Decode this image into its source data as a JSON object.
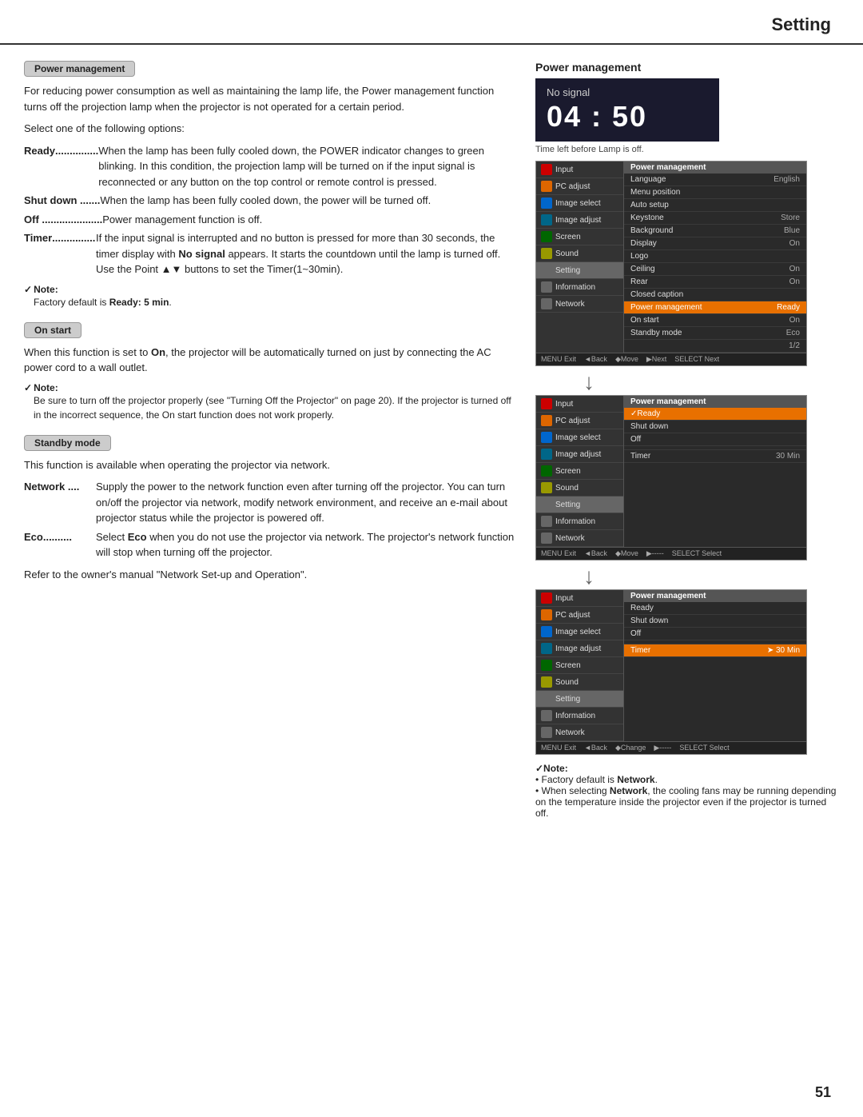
{
  "header": {
    "title": "Setting"
  },
  "left": {
    "power_management_label": "Power management",
    "power_management_intro": "For reducing power consumption as well as maintaining the lamp life, the Power management function turns off the projection lamp when the projector is not operated for a certain period.",
    "select_options": "Select one of the following options:",
    "definitions": [
      {
        "term": "Ready",
        "dots": "...............",
        "desc": "When the lamp has been fully cooled down, the POWER indicator changes to green blinking. In this condition, the projection lamp will be turned on if the input signal is reconnected or any button on the top control or remote control is pressed."
      },
      {
        "term": "Shut down",
        "dots": " .......",
        "desc": "When the lamp has been fully cooled down, the power will be turned off."
      },
      {
        "term": "Off",
        "dots": " ...................",
        "desc": "Power management function is off."
      },
      {
        "term": "Timer",
        "dots": "...............",
        "desc": "If the input signal is interrupted and no button is pressed for more than 30 seconds, the timer display with No signal appears. It starts the countdown until the lamp is turned off. Use the Point ▲▼ buttons to set the Timer(1~30min)."
      }
    ],
    "note1_title": "Note:",
    "note1_text": "Factory default is Ready: 5 min.",
    "on_start_label": "On start",
    "on_start_text": "When this function is set to On, the projector will be automatically turned on just by connecting the AC power cord to a wall outlet.",
    "note2_title": "Note:",
    "note2_text": "Be sure to turn off the projector properly (see \"Turning Off the Projector\" on page 20). If the projector is turned off in the incorrect sequence, the On start function does not work properly.",
    "standby_mode_label": "Standby mode",
    "standby_mode_text": "This function is available when operating the projector via network.",
    "standby_defs": [
      {
        "term": "Network",
        "dots": " ....",
        "desc": "Supply the power to the network function even after turning off the projector. You can turn on/off the projector via network, modify network environment, and receive an e-mail about projector status while the projector is powered off."
      },
      {
        "term": "Eco",
        "dots": "..........",
        "desc": "Select Eco when you do not use the projector via network. The projector's network function will stop when turning off the projector."
      }
    ],
    "refer_text": "Refer to the owner's manual \"Network Set-up and Operation\"."
  },
  "right": {
    "pm_title": "Power management",
    "no_signal": "No signal",
    "timer_display": "04 : 50",
    "time_left_caption": "Time left before Lamp is off.",
    "panels": [
      {
        "id": "panel1",
        "left_items": [
          {
            "label": "Input",
            "icon": "red"
          },
          {
            "label": "PC adjust",
            "icon": "orange"
          },
          {
            "label": "Image select",
            "icon": "blue"
          },
          {
            "label": "Image adjust",
            "icon": "teal"
          },
          {
            "label": "Screen",
            "icon": "green"
          },
          {
            "label": "Sound",
            "icon": "yellow"
          },
          {
            "label": "Setting",
            "icon": "gray",
            "active": true
          },
          {
            "label": "Information",
            "icon": "gray"
          },
          {
            "label": "Network",
            "icon": "gray"
          }
        ],
        "right_header": "Power management",
        "right_items": [
          {
            "label": "Language",
            "val": "English"
          },
          {
            "label": "Menu position",
            "val": ""
          },
          {
            "label": "Auto setup",
            "val": ""
          },
          {
            "label": "Keystone",
            "val": "Store"
          },
          {
            "label": "Background",
            "val": "Blue"
          },
          {
            "label": "Display",
            "val": "On"
          },
          {
            "label": "Logo",
            "val": ""
          },
          {
            "label": "Ceiling",
            "val": "On"
          },
          {
            "label": "Rear",
            "val": "On"
          },
          {
            "label": "Closed caption",
            "val": ""
          },
          {
            "label": "Power management",
            "val": "Ready",
            "highlighted": true
          },
          {
            "label": "On start",
            "val": "On"
          },
          {
            "label": "Standby mode",
            "val": "Eco"
          },
          {
            "label": "",
            "val": "1/2"
          }
        ],
        "bottom_bar": [
          "MENU Exit",
          "◄Back",
          "◆Move",
          "▶Next",
          "SELECT Next"
        ]
      },
      {
        "id": "panel2",
        "left_items": [
          {
            "label": "Input",
            "icon": "red"
          },
          {
            "label": "PC adjust",
            "icon": "orange"
          },
          {
            "label": "Image select",
            "icon": "blue"
          },
          {
            "label": "Image adjust",
            "icon": "teal"
          },
          {
            "label": "Screen",
            "icon": "green"
          },
          {
            "label": "Sound",
            "icon": "yellow"
          },
          {
            "label": "Setting",
            "icon": "gray",
            "active": true
          },
          {
            "label": "Information",
            "icon": "gray"
          },
          {
            "label": "Network",
            "icon": "gray"
          }
        ],
        "right_header": "Power management",
        "right_items": [
          {
            "label": "✓Ready",
            "val": "",
            "highlighted": true
          },
          {
            "label": "Shut down",
            "val": ""
          },
          {
            "label": "Off",
            "val": ""
          },
          {
            "label": "",
            "val": ""
          },
          {
            "label": "Timer",
            "val": "30 Min"
          }
        ],
        "bottom_bar": [
          "MENU Exit",
          "◄Back",
          "◆Move",
          "▶-----",
          "SELECT Select"
        ]
      },
      {
        "id": "panel3",
        "left_items": [
          {
            "label": "Input",
            "icon": "red"
          },
          {
            "label": "PC adjust",
            "icon": "orange"
          },
          {
            "label": "Image select",
            "icon": "blue"
          },
          {
            "label": "Image adjust",
            "icon": "teal"
          },
          {
            "label": "Screen",
            "icon": "green"
          },
          {
            "label": "Sound",
            "icon": "yellow"
          },
          {
            "label": "Setting",
            "icon": "gray",
            "active": true
          },
          {
            "label": "Information",
            "icon": "gray"
          },
          {
            "label": "Network",
            "icon": "gray"
          }
        ],
        "right_header": "Power management",
        "right_items": [
          {
            "label": "Ready",
            "val": ""
          },
          {
            "label": "Shut down",
            "val": ""
          },
          {
            "label": "Off",
            "val": ""
          },
          {
            "label": "",
            "val": ""
          },
          {
            "label": "Timer",
            "val": "➤ 30 Min",
            "highlighted": true
          }
        ],
        "bottom_bar": [
          "MENU Exit",
          "◄Back",
          "◆Change",
          "▶-----",
          "SELECT Select"
        ]
      }
    ],
    "right_notes": [
      "✓Note:",
      "• Factory default is Network.",
      "• When selecting Network, the cooling fans may be running depending on the temperature inside the projector even if the projector is turned off."
    ]
  },
  "page_number": "51"
}
